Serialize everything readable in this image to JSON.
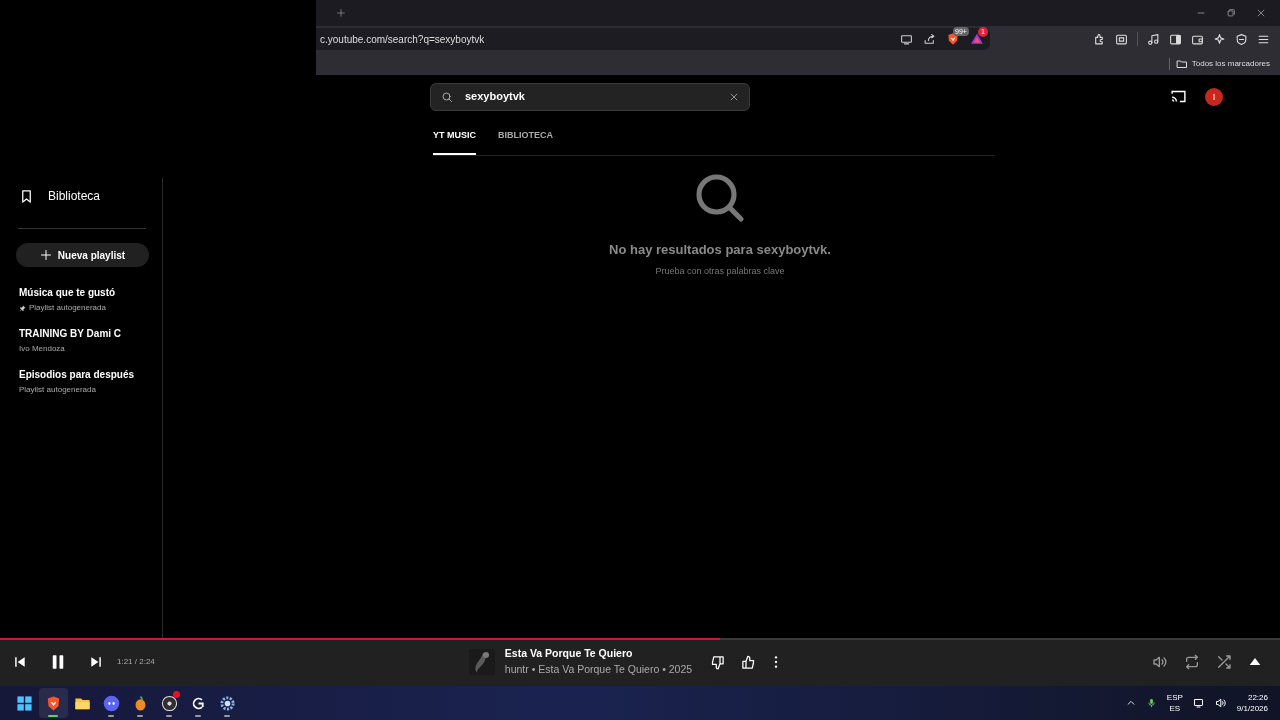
{
  "browser": {
    "address": "c.youtube.com/search?q=sexyboytvk",
    "shield_badge": "99+",
    "rewards_badge": "1",
    "bookmarks_folder": "Todos los marcadores"
  },
  "sidebar": {
    "items": [
      {
        "label": "Biblioteca"
      }
    ],
    "new_playlist": "Nueva playlist",
    "playlists": [
      {
        "title": "Música que te gustó",
        "subtitle": "Playlist autogenerada",
        "pinned": true
      },
      {
        "title": "TRAINING BY Dami C",
        "subtitle": "Ivo Mendoza",
        "pinned": false
      },
      {
        "title": "Episodios para después",
        "subtitle": "Playlist autogenerada",
        "pinned": false
      }
    ]
  },
  "search": {
    "value": "sexyboytvk"
  },
  "account": {
    "initial": "I"
  },
  "tabs": [
    {
      "label": "YT MUSIC",
      "selected": true
    },
    {
      "label": "BIBLIOTECA",
      "selected": false
    }
  ],
  "empty_state": {
    "message": "No hay resultados para sexyboytvk.",
    "hint": "Prueba con otras palabras clave"
  },
  "player": {
    "playing": true,
    "time": "1:21 / 2:24",
    "level": 0.5625,
    "title": "Esta Va Porque Te Quiero",
    "subtitle": "huntr • Esta Va Porque Te Quiero • 2025"
  },
  "taskbar": {
    "apps": [
      {
        "kind": "start",
        "active": false,
        "running": false,
        "notification": false
      },
      {
        "kind": "browser",
        "active": true,
        "running": true,
        "notification": false
      },
      {
        "kind": "files",
        "active": false,
        "running": false,
        "notification": false
      },
      {
        "kind": "chat",
        "active": false,
        "running": true,
        "notification": false
      },
      {
        "kind": "daw",
        "active": false,
        "running": true,
        "notification": false
      },
      {
        "kind": "recorder",
        "active": false,
        "running": true,
        "notification": true
      },
      {
        "kind": "mouse",
        "active": false,
        "running": true,
        "notification": false
      },
      {
        "kind": "settings",
        "active": false,
        "running": true,
        "notification": false
      }
    ],
    "language": "ESP",
    "layout": "ES",
    "time": "22:26",
    "date": "9/1/2026"
  }
}
